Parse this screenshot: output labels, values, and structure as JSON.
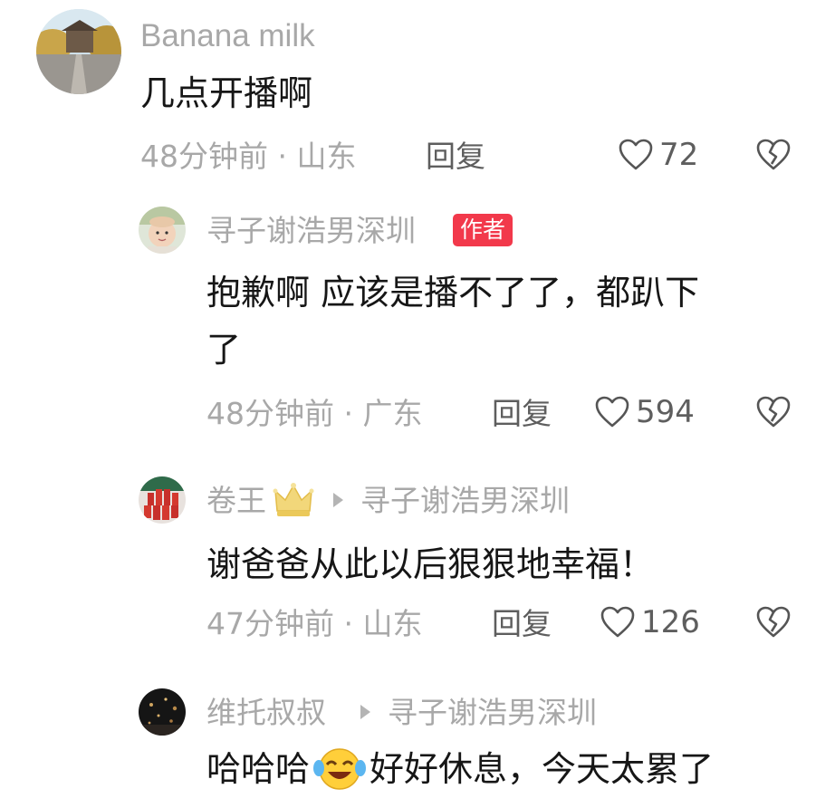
{
  "comments": [
    {
      "username": "Banana milk",
      "text": "几点开播啊",
      "time": "48分钟前",
      "location": "山东",
      "reply_label": "回复",
      "likes": "72",
      "icons": {
        "like": "heart-outline-icon",
        "dislike": "broken-heart-icon"
      }
    },
    {
      "username": "寻子谢浩男深圳",
      "badge": "作者",
      "text_line1": "抱歉啊 应该是播不了了，都趴下",
      "text_line2": "了",
      "time": "48分钟前",
      "location": "广东",
      "reply_label": "回复",
      "likes": "594"
    },
    {
      "username": "卷王",
      "badge_icon": "crown-icon",
      "reply_to": "寻子谢浩男深圳",
      "text": "谢爸爸从此以后狠狠地幸福！",
      "time": "47分钟前",
      "location": "山东",
      "reply_label": "回复",
      "likes": "126"
    },
    {
      "username": "维托叔叔",
      "reply_to": "寻子谢浩男深圳",
      "text_before_emoji": "哈哈哈",
      "emoji": "laughing-tears-emoji",
      "text_after_emoji": "好好休息，今天太累了"
    }
  ],
  "meta_separator": "·",
  "colors": {
    "badge": "#f2394b",
    "meta": "#a8a8a8",
    "text": "#161616"
  }
}
